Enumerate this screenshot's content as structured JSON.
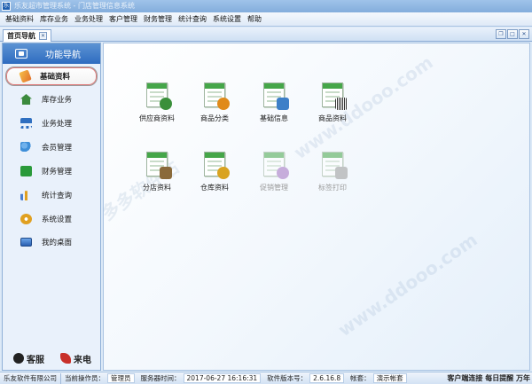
{
  "window": {
    "title": "乐友超市管理系统 - 门店管理信息系统"
  },
  "menu": [
    {
      "label": "基础资料"
    },
    {
      "label": "库存业务"
    },
    {
      "label": "业务处理"
    },
    {
      "label": "客户管理"
    },
    {
      "label": "财务管理"
    },
    {
      "label": "统计查询"
    },
    {
      "label": "系统设置"
    },
    {
      "label": "帮助"
    }
  ],
  "tab": {
    "label": "首页导航"
  },
  "sidebar": {
    "header": "功能导航",
    "items": [
      {
        "label": "基础资料",
        "icon": "pencil-icon",
        "color": "#e58a2a"
      },
      {
        "label": "库存业务",
        "icon": "house-icon",
        "color": "#3b8a3d"
      },
      {
        "label": "业务处理",
        "icon": "cart-icon",
        "color": "#2f6fc0"
      },
      {
        "label": "会员管理",
        "icon": "users-icon",
        "color": "#3f8fd8"
      },
      {
        "label": "财务管理",
        "icon": "chart-line-icon",
        "color": "#2a9a3a"
      },
      {
        "label": "统计查询",
        "icon": "bar-chart-icon",
        "color": "#4a7fd0"
      },
      {
        "label": "系统设置",
        "icon": "gear-icon",
        "color": "#e0a020"
      },
      {
        "label": "我的桌面",
        "icon": "monitor-icon",
        "color": "#3a6fb8"
      }
    ],
    "bottom": {
      "service": "客服",
      "phone": "来电"
    }
  },
  "modules": [
    {
      "label": "供应商资料",
      "icon": "supplier-icon",
      "badge": "#3a8f3a",
      "disabled": false
    },
    {
      "label": "商品分类",
      "icon": "category-icon",
      "badge": "#e08a1a",
      "disabled": false
    },
    {
      "label": "基础信息",
      "icon": "info-icon",
      "badge": "#3d7fc8",
      "disabled": false
    },
    {
      "label": "商品资料",
      "icon": "barcode-icon",
      "badge": "#333333",
      "disabled": false
    },
    {
      "label": "分店资料",
      "icon": "store-icon",
      "badge": "#8a6a3a",
      "disabled": false
    },
    {
      "label": "仓库资料",
      "icon": "warehouse-icon",
      "badge": "#d9a320",
      "disabled": false
    },
    {
      "label": "促销管理",
      "icon": "promotion-icon",
      "badge": "#a070c0",
      "disabled": true
    },
    {
      "label": "标签打印",
      "icon": "label-print-icon",
      "badge": "#999999",
      "disabled": true
    }
  ],
  "status": {
    "company": "乐友软件有限公司",
    "operator_label": "当前操作员：",
    "operator": "管理员",
    "server_time_label": "服务器时间：",
    "server_time": "2017-06-27 16:16:31",
    "version_label": "软件版本号：",
    "version": "2.6.16.8",
    "account_label": "帐套：",
    "account": "演示帐套",
    "right_text": "客户端连接 每日提醒 万年"
  },
  "colors": {
    "accent": "#2e6cc0",
    "header": "#5c93d3"
  }
}
